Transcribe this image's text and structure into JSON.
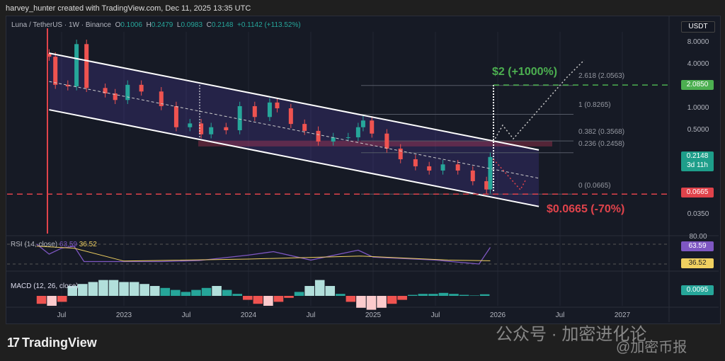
{
  "header": "harvey_hunter created with TradingView.com, Dec 11, 2025 13:35 UTC",
  "legend": {
    "symbol": "Luna / TetherUS · 1W · Binance",
    "o_label": "O",
    "o": "0.1006",
    "h_label": "H",
    "h": "0.2479",
    "l_label": "L",
    "l": "0.0983",
    "c_label": "C",
    "c": "0.2148",
    "change": "+0.1142 (+113.52%)"
  },
  "axis": {
    "currency": "USDT",
    "ticks": [
      "8.0000",
      "4.0000",
      "1.0000",
      "0.5000",
      "0.0350"
    ],
    "rsi_tick": "80.00"
  },
  "tags": {
    "target": "2.0850",
    "price": "0.2148",
    "countdown": "3d 11h",
    "stop": "0.0665",
    "rsi": "63.59",
    "rsi_ma": "36.52",
    "macd": "0.0095"
  },
  "annotations": {
    "up": "$2 (+1000%)",
    "down": "$0.0665 (-70%)"
  },
  "fib": [
    "2.618 (2.0563)",
    "1 (0.8265)",
    "0.382 (0.3568)",
    "0.236 (0.2458)",
    "0 (0.0665)"
  ],
  "rsi_label": "RSI (14, close)",
  "rsi_v1": "63.59",
  "rsi_v2": "36.52",
  "macd_label": "MACD (12, 26, close)",
  "brand": "TradingView",
  "watermark1": "公众号 · 加密进化论",
  "watermark2": "@加密币报",
  "colors": {
    "up": "#26a69a",
    "down": "#ef5350",
    "rsi": "#7e57c2",
    "rsi_ma": "#f0d060",
    "target": "#4caf50"
  },
  "chart_data": {
    "type": "candlestick",
    "scale": "log",
    "ylim": [
      0.03,
      10
    ],
    "xlim": [
      2022.05,
      2027.4
    ],
    "x_ticks": [
      {
        "t": 2022.5,
        "label": "Jul"
      },
      {
        "t": 2023,
        "label": "2023"
      },
      {
        "t": 2023.5,
        "label": "Jul"
      },
      {
        "t": 2024,
        "label": "2024"
      },
      {
        "t": 2024.5,
        "label": "Jul"
      },
      {
        "t": 2025,
        "label": "2025"
      },
      {
        "t": 2025.5,
        "label": "Jul"
      },
      {
        "t": 2026,
        "label": "2026"
      },
      {
        "t": 2026.5,
        "label": "Jul"
      },
      {
        "t": 2027,
        "label": "2027"
      }
    ],
    "closes": [
      [
        2022.4,
        5.1
      ],
      [
        2022.45,
        2.1
      ],
      [
        2022.55,
        2.0
      ],
      [
        2022.62,
        7.6
      ],
      [
        2022.7,
        1.9
      ],
      [
        2022.85,
        1.6
      ],
      [
        2022.93,
        1.3
      ],
      [
        2023.03,
        2.1
      ],
      [
        2023.14,
        1.7
      ],
      [
        2023.3,
        1.07
      ],
      [
        2023.42,
        0.55
      ],
      [
        2023.53,
        0.62
      ],
      [
        2023.62,
        0.44
      ],
      [
        2023.7,
        0.55
      ],
      [
        2023.82,
        0.5
      ],
      [
        2023.93,
        1.07
      ],
      [
        2024.05,
        0.76
      ],
      [
        2024.17,
        1.2
      ],
      [
        2024.23,
        1.0
      ],
      [
        2024.34,
        0.61
      ],
      [
        2024.45,
        0.49
      ],
      [
        2024.56,
        0.35
      ],
      [
        2024.68,
        0.4
      ],
      [
        2024.8,
        0.4
      ],
      [
        2024.88,
        0.55
      ],
      [
        2024.92,
        0.68
      ],
      [
        2024.99,
        0.45
      ],
      [
        2025.11,
        0.28
      ],
      [
        2025.22,
        0.2
      ],
      [
        2025.34,
        0.16
      ],
      [
        2025.45,
        0.14
      ],
      [
        2025.56,
        0.17
      ],
      [
        2025.68,
        0.14
      ],
      [
        2025.8,
        0.1
      ],
      [
        2025.91,
        0.077
      ],
      [
        2025.94,
        0.2148
      ]
    ],
    "channel": {
      "upper": [
        [
          2022.4,
          5.7
        ],
        [
          2026.33,
          0.268
        ]
      ],
      "lower": [
        [
          2022.4,
          0.955
        ],
        [
          2026.33,
          0.045
        ]
      ]
    },
    "fib_levels": [
      0.0665,
      0.2458,
      0.3568,
      0.8265,
      2.0563
    ],
    "target": 2.085,
    "stop": 0.0665,
    "rsi": [
      [
        2022.3,
        70
      ],
      [
        2022.4,
        50
      ],
      [
        2022.5,
        62
      ],
      [
        2022.6,
        66
      ],
      [
        2022.68,
        35
      ],
      [
        2023.3,
        35
      ],
      [
        2023.6,
        37
      ],
      [
        2024.0,
        48
      ],
      [
        2024.2,
        55
      ],
      [
        2024.5,
        38
      ],
      [
        2024.88,
        58
      ],
      [
        2025.0,
        44
      ],
      [
        2025.5,
        38
      ],
      [
        2025.85,
        30
      ],
      [
        2025.94,
        63.59
      ]
    ],
    "rsi_ma": [
      [
        2022.3,
        66
      ],
      [
        2022.6,
        62
      ],
      [
        2023.0,
        36
      ],
      [
        2024.0,
        40
      ],
      [
        2024.9,
        46
      ],
      [
        2025.6,
        38
      ],
      [
        2025.94,
        36.52
      ]
    ],
    "macd_hist": [
      -0.4,
      -0.5,
      -0.3,
      0.5,
      0.6,
      0.7,
      0.8,
      0.8,
      0.7,
      0.7,
      0.6,
      0.5,
      0.4,
      0.3,
      0.2,
      0.3,
      0.4,
      0.5,
      0.3,
      0.1,
      -0.2,
      -0.4,
      -0.5,
      -0.3,
      -0.1,
      0.2,
      0.5,
      0.8,
      0.5,
      0.1,
      -0.3,
      -0.6,
      -0.7,
      -0.6,
      -0.4,
      -0.2,
      0.05,
      0.1,
      0.1,
      0.15,
      0.1,
      0.05,
      0.02,
      0.08
    ]
  }
}
